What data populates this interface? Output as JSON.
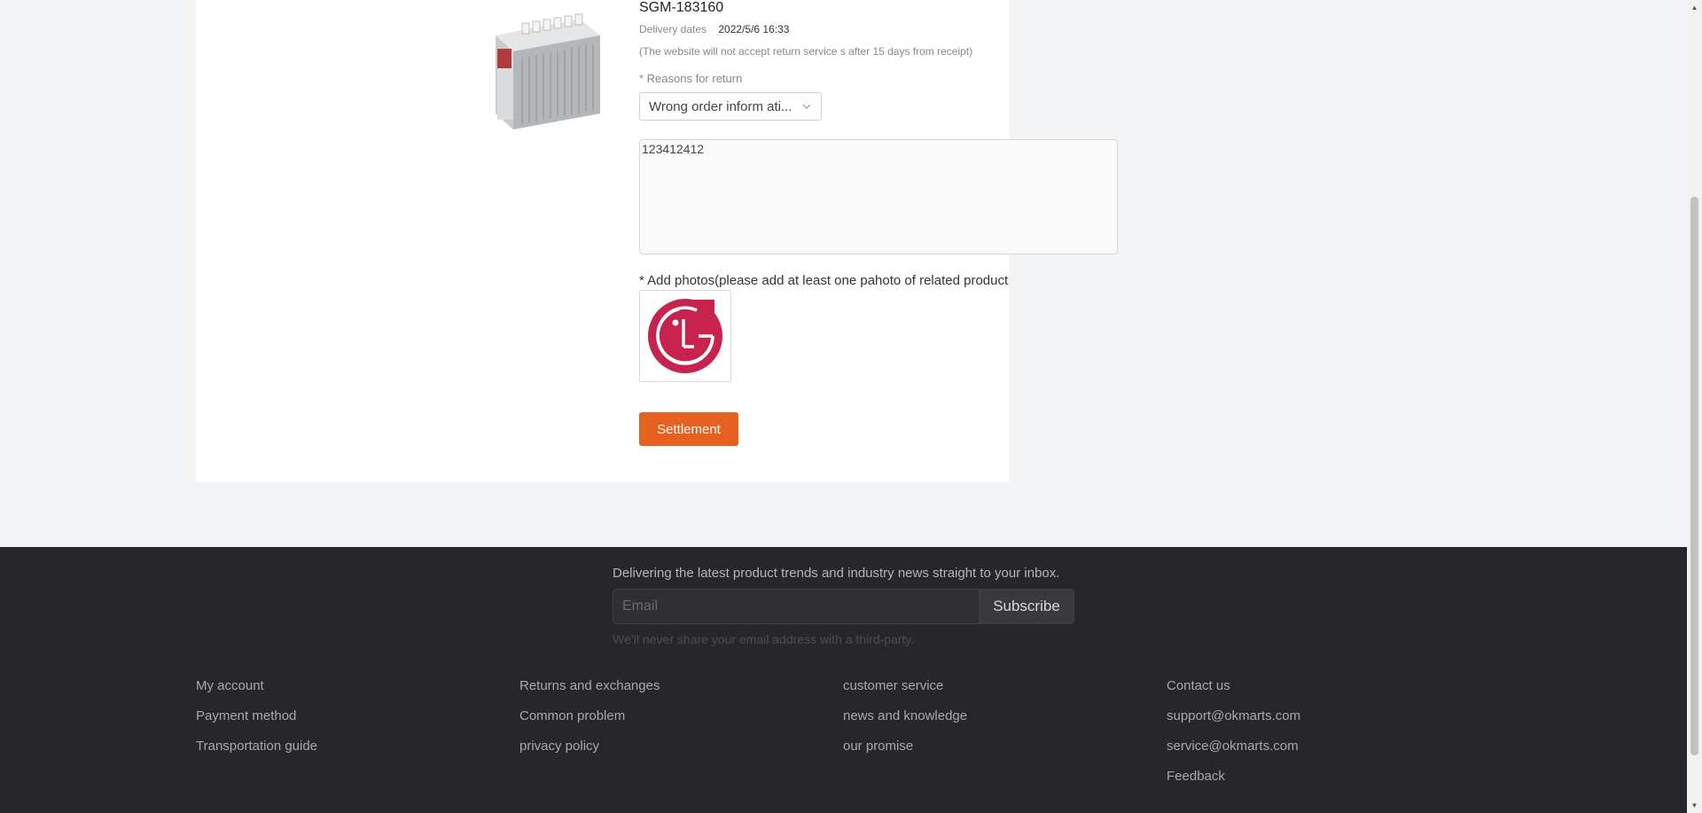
{
  "product": {
    "sku": "SGM-183160",
    "delivery_label": "Delivery dates",
    "delivery_date": "2022/5/6 16:33",
    "return_note": "(The website will not accept return service s after 15 days from receipt)",
    "reason_label": "* Reasons for return",
    "reason_selected": "Wrong order inform ati...",
    "description": "123412412",
    "photos_label": "* Add photos(please add at least one pahoto of related product quality Issues)",
    "photo_icon": "lg-logo",
    "submit_label": "Settlement"
  },
  "footer": {
    "newsletter_text": "Delivering the latest product trends and industry news straight to your inbox.",
    "email_placeholder": "Email",
    "subscribe_label": "Subscribe",
    "privacy_text": "We’ll never share your email address with a third-party.",
    "col1": [
      "My account",
      "Payment method",
      "Transportation guide"
    ],
    "col2": [
      "Returns and exchanges",
      "Common problem",
      "privacy policy"
    ],
    "col3": [
      "customer service",
      "news and knowledge",
      "our promise"
    ],
    "col4": [
      "Contact us",
      "support@okmarts.com",
      "service@okmarts.com",
      "Feedback"
    ]
  },
  "colors": {
    "accent": "#e8601f",
    "footer_bg": "#27272a",
    "lg_red": "#c8234f"
  }
}
